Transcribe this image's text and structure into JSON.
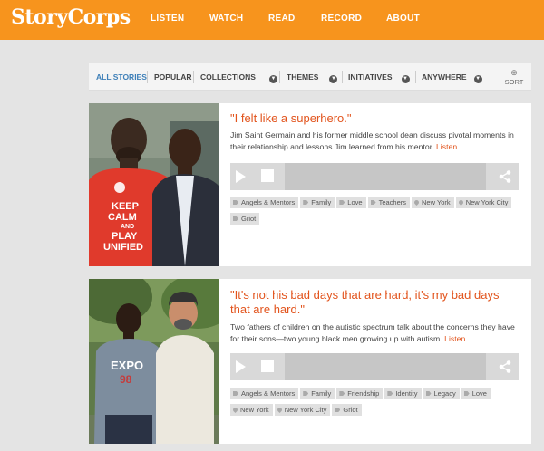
{
  "brand": {
    "logo": "StoryCorps",
    "accent": "#f7941d",
    "link_color": "#e2541d"
  },
  "nav": {
    "items": [
      "LISTEN",
      "WATCH",
      "READ",
      "RECORD",
      "ABOUT"
    ]
  },
  "filters": {
    "all": "ALL STORIES",
    "popular": "POPULAR",
    "collections": "COLLECTIONS",
    "themes": "THEMES",
    "initiatives": "INITIATIVES",
    "anywhere": "ANYWHERE",
    "sort": "SORT"
  },
  "stories": [
    {
      "title": "\"I felt like a superhero.\"",
      "description": "Jim Saint Germain and his former middle school dean discuss pivotal moments in their relationship and lessons Jim learned from his mentor.",
      "listen": "Listen",
      "shirt_text": [
        "KEEP",
        "CALM",
        "AND",
        "PLAY",
        "UNIFIED"
      ],
      "tags": [
        "Angels & Mentors",
        "Family",
        "Love",
        "Teachers"
      ],
      "locations": [
        "New York",
        "New York City"
      ],
      "extra_tags": [
        "Griot"
      ]
    },
    {
      "title": "\"It's not his bad days that are hard, it's my bad days that are hard.\"",
      "description": "Two fathers of children on the autistic spectrum talk about the concerns they have for their sons—two young black men growing up with autism.",
      "listen": "Listen",
      "shirt_text": [
        "EXPO",
        "98"
      ],
      "tags": [
        "Angels & Mentors",
        "Family",
        "Friendship",
        "Identity",
        "Legacy",
        "Love"
      ],
      "locations": [
        "New York",
        "New York City"
      ],
      "extra_tags": [
        "Griot"
      ]
    }
  ]
}
